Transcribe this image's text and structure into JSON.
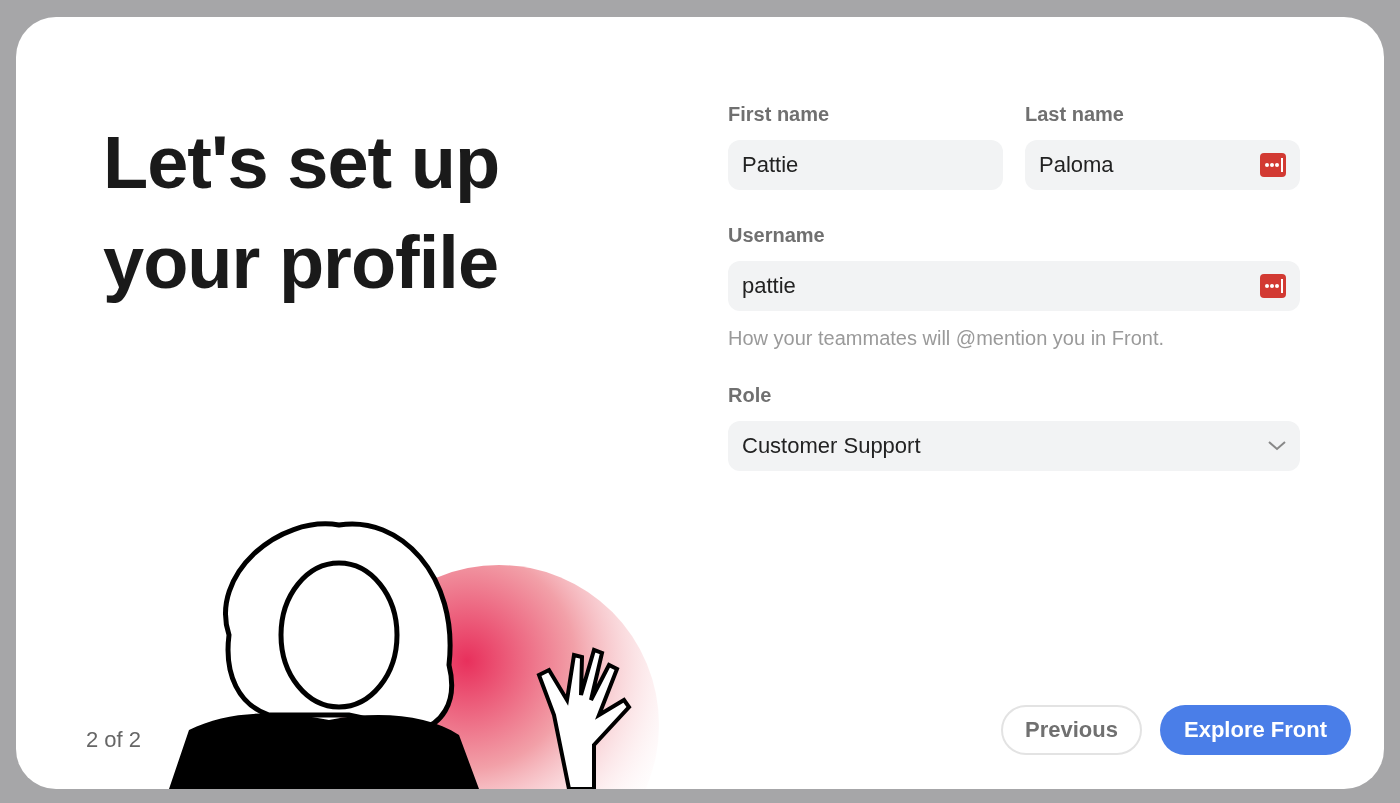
{
  "dialog": {
    "title": "Let's set up your profile",
    "page_indicator": "2 of 2"
  },
  "form": {
    "rows": [
      {
        "fields": [
          {
            "kind": "text",
            "label": "First name",
            "value": "Pattie",
            "autofill_icon": false
          },
          {
            "kind": "text",
            "label": "Last name",
            "value": "Paloma",
            "autofill_icon": true
          }
        ]
      },
      {
        "fields": [
          {
            "kind": "text",
            "label": "Username",
            "value": "pattie",
            "autofill_icon": true,
            "hint": "How your teammates will @mention you in Front."
          }
        ]
      },
      {
        "fields": [
          {
            "kind": "select",
            "label": "Role",
            "value": "Customer Support",
            "autofill_icon": false
          }
        ]
      }
    ]
  },
  "buttons": [
    {
      "kind": "secondary",
      "label": "Previous"
    },
    {
      "kind": "primary",
      "label": "Explore Front"
    }
  ]
}
